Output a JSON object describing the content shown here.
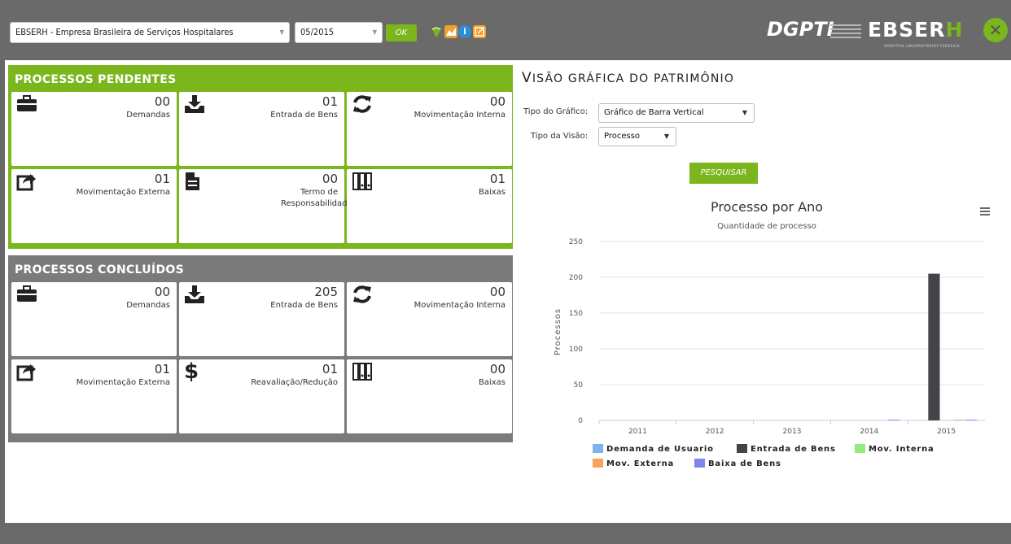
{
  "topbar": {
    "org_select": "EBSERH - Empresa Brasileira de Serviços Hospitalares",
    "period_select": "05/2015",
    "ok_label": "OK",
    "brand_left": "DGPTI",
    "brand_right_main": "EBSER",
    "brand_right_accent": "H",
    "brand_sub": "HOSPITAIS UNIVERSITÁRIOS FEDERAIS",
    "colors": {
      "bar": "#6a6a6a",
      "accent": "#7ab61c"
    },
    "icons": [
      "brazil-map-icon",
      "chart-icon",
      "info-icon",
      "edit-icon"
    ]
  },
  "pendentes": {
    "title": "PROCESSOS PENDENTES",
    "color": "#7ab61c",
    "cards": [
      {
        "icon": "briefcase-icon",
        "count": "00",
        "label": "Demandas"
      },
      {
        "icon": "download-tray-icon",
        "count": "01",
        "label": "Entrada de Bens"
      },
      {
        "icon": "refresh-icon",
        "count": "00",
        "label": "Movimentação Interna"
      },
      {
        "icon": "share-arrow-icon",
        "count": "01",
        "label": "Movimentação Externa"
      },
      {
        "icon": "document-icon",
        "count": "00",
        "label": "Termo de Responsabilidade"
      },
      {
        "icon": "binders-icon",
        "count": "01",
        "label": "Baixas"
      }
    ]
  },
  "concluidos": {
    "title": "PROCESSOS CONCLUÍDOS",
    "color": "#7b7b7b",
    "cards": [
      {
        "icon": "briefcase-icon",
        "count": "00",
        "label": "Demandas"
      },
      {
        "icon": "download-tray-icon",
        "count": "205",
        "label": "Entrada de Bens"
      },
      {
        "icon": "refresh-icon",
        "count": "00",
        "label": "Movimentação Interna"
      },
      {
        "icon": "share-arrow-icon",
        "count": "01",
        "label": "Movimentação Externa"
      },
      {
        "icon": "dollar-icon",
        "count": "01",
        "label": "Reavaliação/Redução"
      },
      {
        "icon": "binders-icon",
        "count": "00",
        "label": "Baixas"
      }
    ]
  },
  "right": {
    "title_first": "V",
    "title_rest": "ISÃO GRÁFICA DO PATRIMÔNIO",
    "tipo_grafico_label": "Tipo do Gráfico:",
    "tipo_grafico_value": "Gráfico de Barra Vertical",
    "tipo_visao_label": "Tipo da Visão:",
    "tipo_visao_value": "Processo",
    "pesquisar_label": "PESQUISAR"
  },
  "chart_data": {
    "type": "bar",
    "title": "Processo por Ano",
    "subtitle": "Quantidade de processo",
    "ylabel": "Processos",
    "xlabel": "",
    "ylim": [
      0,
      250
    ],
    "yticks": [
      0,
      50,
      100,
      150,
      200,
      250
    ],
    "grid": true,
    "legend_position": "bottom",
    "categories": [
      "2011",
      "2012",
      "2013",
      "2014",
      "2015"
    ],
    "series": [
      {
        "name": "Demanda de Usuario",
        "color": "#7cb5ec",
        "values": [
          0,
          0,
          0,
          0,
          0
        ]
      },
      {
        "name": "Entrada de Bens",
        "color": "#434348",
        "values": [
          0,
          0,
          0,
          0,
          205
        ]
      },
      {
        "name": "Mov. Interna",
        "color": "#90ed7d",
        "values": [
          0,
          0,
          0,
          0,
          0
        ]
      },
      {
        "name": "Mov. Externa",
        "color": "#f7a35c",
        "values": [
          0,
          0,
          0,
          0,
          1
        ]
      },
      {
        "name": "Baixa de Bens",
        "color": "#8085e9",
        "values": [
          0,
          0,
          0,
          1,
          1
        ]
      }
    ]
  }
}
